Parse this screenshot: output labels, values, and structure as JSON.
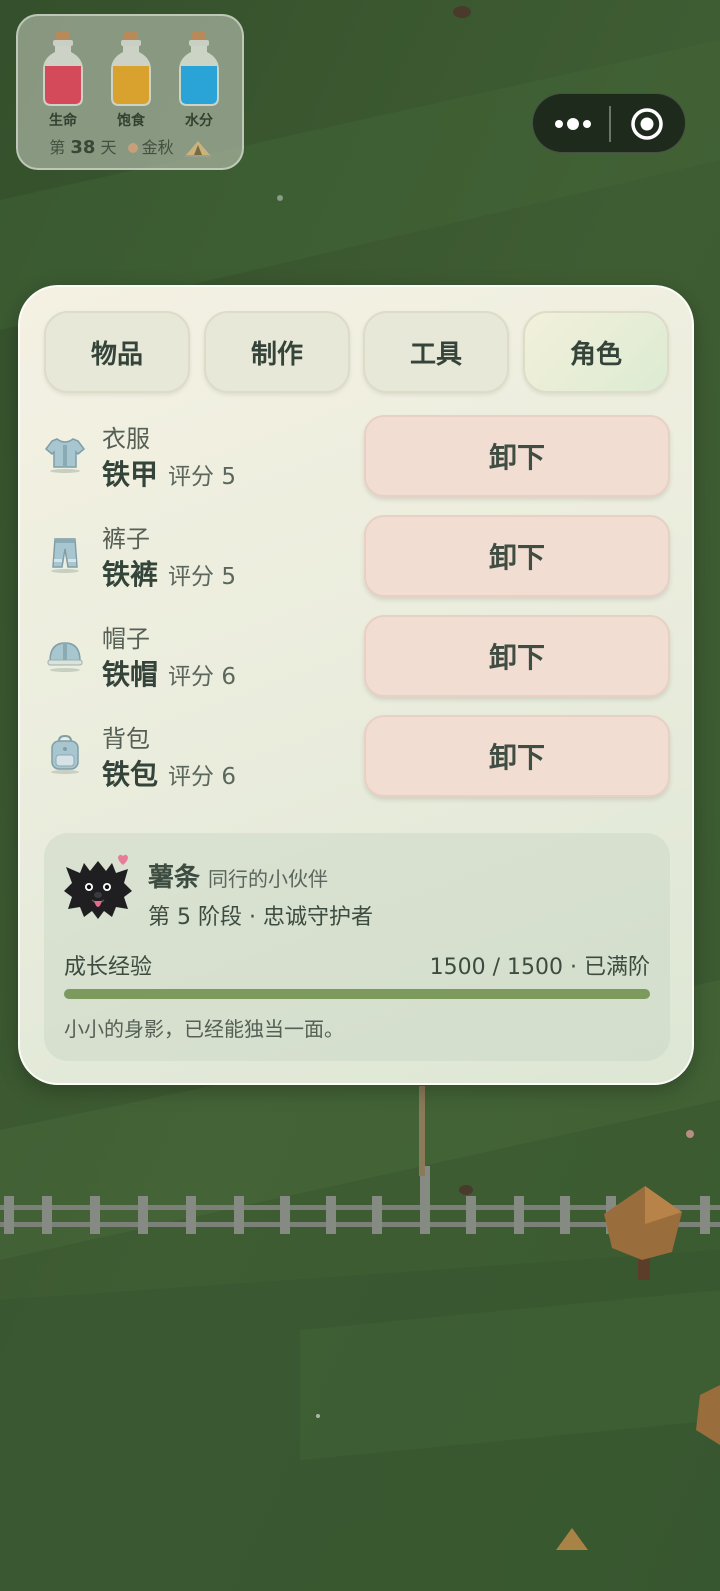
{
  "hud": {
    "bottles": [
      {
        "label": "生命",
        "icon": "health-bottle-icon",
        "color": "#d44a5a"
      },
      {
        "label": "饱食",
        "icon": "hunger-bottle-icon",
        "color": "#d9a12e"
      },
      {
        "label": "水分",
        "icon": "water-bottle-icon",
        "color": "#2aa4d6"
      }
    ],
    "day_prefix": "第",
    "day_number": "38",
    "day_suffix": "天",
    "season": "金秋",
    "season_color": "#c7a07a",
    "camp_icon": "tent-icon"
  },
  "capsule": {
    "more_icon": "more-dots-icon",
    "close_icon": "target-circle-icon"
  },
  "tabs": [
    {
      "label": "物品",
      "active": false
    },
    {
      "label": "制作",
      "active": false
    },
    {
      "label": "工具",
      "active": false
    },
    {
      "label": "角色",
      "active": true
    }
  ],
  "equipment": [
    {
      "slot": "衣服",
      "item": "铁甲",
      "score": "评分 5",
      "action": "卸下",
      "icon": "shirt-icon"
    },
    {
      "slot": "裤子",
      "item": "铁裤",
      "score": "评分 5",
      "action": "卸下",
      "icon": "pants-icon"
    },
    {
      "slot": "帽子",
      "item": "铁帽",
      "score": "评分 6",
      "action": "卸下",
      "icon": "helmet-icon"
    },
    {
      "slot": "背包",
      "item": "铁包",
      "score": "评分 6",
      "action": "卸下",
      "icon": "backpack-icon"
    }
  ],
  "pet": {
    "name": "薯条",
    "role": "同行的小伙伴",
    "stage": "第 5 阶段 · 忠诚守护者",
    "xp_label": "成长经验",
    "xp_value": "1500 / 1500 · 已满阶",
    "xp_progress": 1.0,
    "description": "小小的身影，已经能独当一面。",
    "avatar_icon": "black-dog-avatar-icon",
    "accent_color": "#7d9a5e"
  }
}
